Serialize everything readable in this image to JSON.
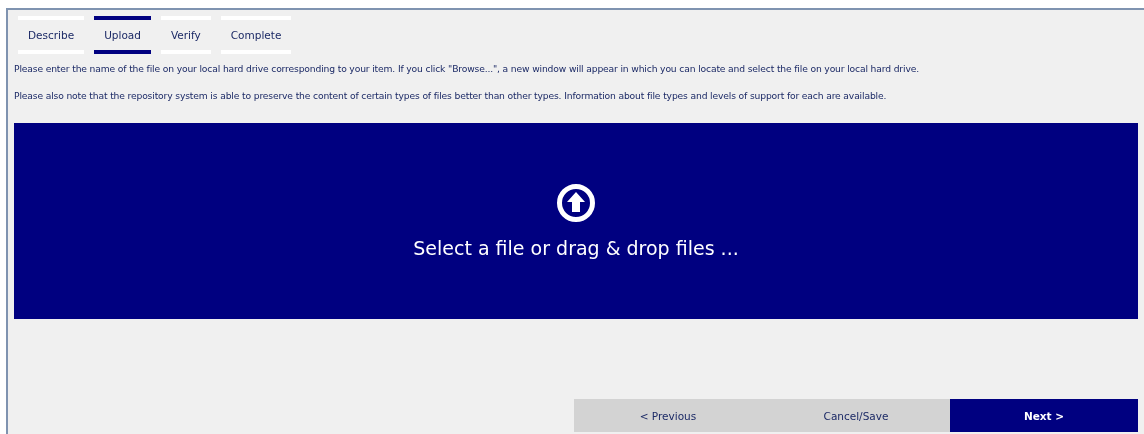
{
  "tabs": [
    {
      "label": "Describe",
      "selected": false
    },
    {
      "label": "Upload",
      "selected": true
    },
    {
      "label": "Verify",
      "selected": false
    },
    {
      "label": "Complete",
      "selected": false
    }
  ],
  "instructions": [
    "Please enter the name of the file on your local hard drive corresponding to your item. If you click \"Browse...\", a new window will appear in which you can locate and select the file on your local hard drive.",
    "Please also note that the repository system is able to preserve the content of certain types of files better than other types. Information about file types and levels of support for each are available."
  ],
  "dropzone": {
    "label": "Select a file or drag & drop files ..."
  },
  "buttons": [
    {
      "label": "< Previous",
      "kind": "secondary"
    },
    {
      "label": "Cancel/Save",
      "kind": "secondary"
    },
    {
      "label": "Next >",
      "kind": "primary"
    }
  ]
}
